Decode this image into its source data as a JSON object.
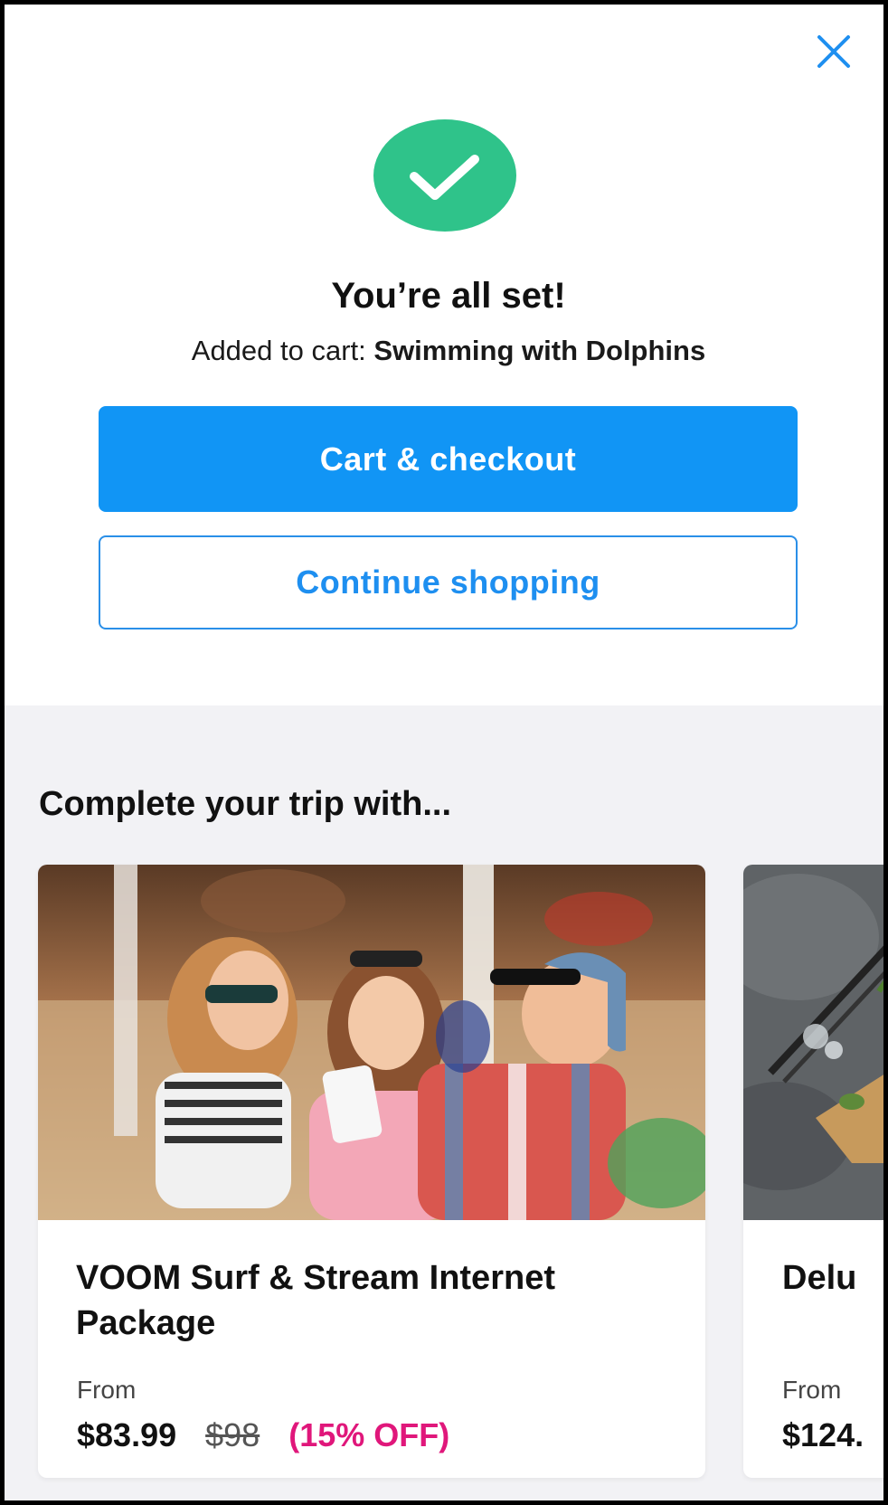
{
  "close": {
    "icon": "close-icon",
    "color": "#1e8ff0"
  },
  "success": {
    "icon": "checkmark-icon",
    "color": "#2fc38a"
  },
  "confirmation": {
    "title": "You’re all set!",
    "added_prefix": "Added to cart: ",
    "added_item": "Swimming with Dolphins"
  },
  "actions": {
    "primary_label": "Cart & checkout",
    "secondary_label": "Continue shopping",
    "primary_color": "#1195f5"
  },
  "recommendations": {
    "title": "Complete your trip with...",
    "cards": [
      {
        "title": "VOOM Surf & Stream Internet Package",
        "from_label": "From",
        "price": "$83.99",
        "original_price": "$98",
        "discount": "(15% OFF)",
        "image": "kids-on-beach-with-phone-photo"
      },
      {
        "title": "Delu",
        "from_label": "From",
        "price": "$124.",
        "image": "drinks-on-stone-counter-photo"
      }
    ]
  }
}
